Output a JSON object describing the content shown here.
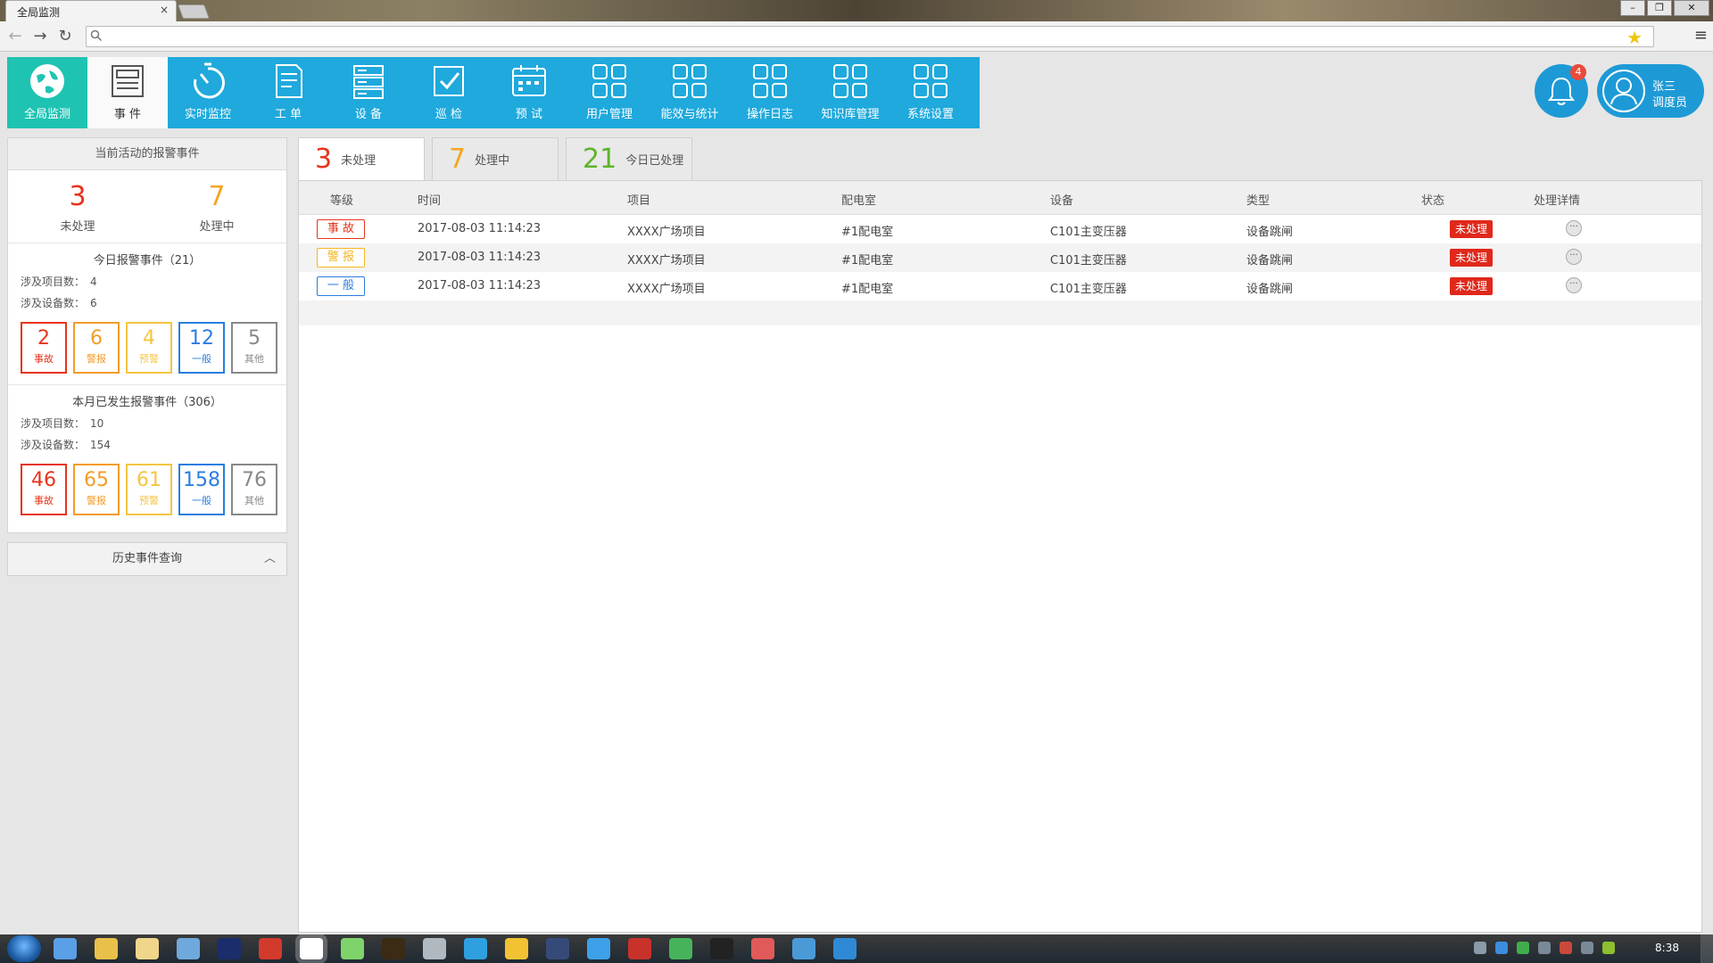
{
  "browser": {
    "tab_title": "全局监测",
    "tab_close": "×",
    "window_min": "–",
    "window_restore": "❐",
    "window_close": "✕",
    "back": "←",
    "forward": "→",
    "reload": "↻",
    "url": "",
    "menu": "≡",
    "bookmark": "★"
  },
  "nav": {
    "items": [
      {
        "label": "全局监测",
        "icon": "globe-icon"
      },
      {
        "label": "事 件",
        "icon": "newspaper-icon"
      },
      {
        "label": "实时监控",
        "icon": "stopwatch-icon"
      },
      {
        "label": "工 单",
        "icon": "document-icon"
      },
      {
        "label": "设 备",
        "icon": "server-icon"
      },
      {
        "label": "巡 检",
        "icon": "checkbox-icon"
      },
      {
        "label": "预 试",
        "icon": "calendar-icon"
      },
      {
        "label": "用户管理",
        "icon": "grid-icon"
      },
      {
        "label": "能效与统计",
        "icon": "grid-icon"
      },
      {
        "label": "操作日志",
        "icon": "grid-icon"
      },
      {
        "label": "知识库管理",
        "icon": "grid-icon"
      },
      {
        "label": "系统设置",
        "icon": "grid-icon"
      }
    ],
    "active_index": 1
  },
  "header": {
    "notification_count": "4",
    "user_name": "张三",
    "user_role": "调度员"
  },
  "left": {
    "title": "当前活动的报警事件",
    "unprocessed": {
      "num": "3",
      "label": "未处理",
      "color": "#e8341c"
    },
    "processing": {
      "num": "7",
      "label": "处理中",
      "color": "#f5a623"
    },
    "today": {
      "title": "今日报警事件（21）",
      "projects_label": "涉及项目数：",
      "projects_value": "4",
      "devices_label": "涉及设备数：",
      "devices_value": "6",
      "boxes": [
        {
          "num": "2",
          "label": "事故",
          "color": "#e8341c"
        },
        {
          "num": "6",
          "label": "警报",
          "color": "#f39c2a"
        },
        {
          "num": "4",
          "label": "预警",
          "color": "#f5c542"
        },
        {
          "num": "12",
          "label": "一般",
          "color": "#2b7de1"
        },
        {
          "num": "5",
          "label": "其他",
          "color": "#888888"
        }
      ]
    },
    "month": {
      "title": "本月已发生报警事件（306）",
      "projects_label": "涉及项目数：",
      "projects_value": "10",
      "devices_label": "涉及设备数：",
      "devices_value": "154",
      "boxes": [
        {
          "num": "46",
          "label": "事故",
          "color": "#e8341c"
        },
        {
          "num": "65",
          "label": "警报",
          "color": "#f39c2a"
        },
        {
          "num": "61",
          "label": "预警",
          "color": "#f5c542"
        },
        {
          "num": "158",
          "label": "一般",
          "color": "#2b7de1"
        },
        {
          "num": "76",
          "label": "其他",
          "color": "#888888"
        }
      ]
    },
    "history_label": "历史事件查询",
    "history_chevron": "︿"
  },
  "tabs": [
    {
      "num": "3",
      "label": "未处理",
      "color": "#e8341c"
    },
    {
      "num": "7",
      "label": "处理中",
      "color": "#f5a623"
    },
    {
      "num": "21",
      "label": "今日已处理",
      "color": "#5db42c"
    }
  ],
  "table": {
    "headers": [
      "等级",
      "时间",
      "项目",
      "配电室",
      "设备",
      "类型",
      "状态",
      "处理详情"
    ],
    "rows": [
      {
        "level": "事 故",
        "level_color": "#e8341c",
        "time": "2017-08-03 11:14:23",
        "project": "XXXX广场项目",
        "room": "#1配电室",
        "device": "C101主变压器",
        "type": "设备跳闸",
        "status": "未处理",
        "detail": "···"
      },
      {
        "level": "警 报",
        "level_color": "#f5b51f",
        "time": "2017-08-03 11:14:23",
        "project": "XXXX广场项目",
        "room": "#1配电室",
        "device": "C101主变压器",
        "type": "设备跳闸",
        "status": "未处理",
        "detail": "···"
      },
      {
        "level": "一 般",
        "level_color": "#2b7de1",
        "time": "2017-08-03 11:14:23",
        "project": "XXXX广场项目",
        "room": "#1配电室",
        "device": "C101主变压器",
        "type": "设备跳闸",
        "status": "未处理",
        "detail": "···"
      }
    ]
  },
  "taskbar": {
    "clock": "8:38",
    "apps": [
      "start-menu",
      "file-manager",
      "media-player",
      "explorer",
      "remote-desktop",
      "photoshop",
      "netease-music",
      "chrome",
      "color-app",
      "illustrator",
      "after-effects",
      "qq-browser",
      "360-browser",
      "cinema4d",
      "internet-explorer",
      "weibo",
      "ie-green",
      "pen-tool",
      "map-pin",
      "messenger",
      "teamviewer"
    ]
  }
}
